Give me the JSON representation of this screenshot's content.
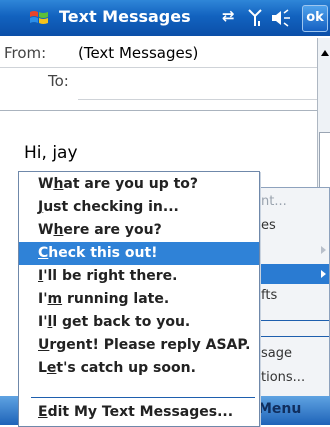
{
  "titlebar": {
    "title": "Text Messages",
    "ok_label": "ok",
    "icons": [
      "windows-flag-icon",
      "connectivity-icon",
      "signal-icon",
      "volume-icon"
    ]
  },
  "header": {
    "from_label": "From:",
    "from_value": "(Text Messages)",
    "to_label": "To:",
    "to_value": ""
  },
  "message": {
    "body": "Hi, jay"
  },
  "main_menu": {
    "items": [
      "nt...",
      "es",
      "fts",
      "sage",
      "tions..."
    ]
  },
  "popup_menu": {
    "items": [
      {
        "label": "What are you up to?",
        "underline_index": 1
      },
      {
        "label": "Just checking in...",
        "underline_index": 0
      },
      {
        "label": "Where are you?",
        "underline_index": 1
      },
      {
        "label": "Check this out!",
        "underline_index": 0,
        "selected": true
      },
      {
        "label": "I'll be right there.",
        "underline_index": 0
      },
      {
        "label": "I'm running late.",
        "underline_index": 2
      },
      {
        "label": "I'll get back to you.",
        "underline_index": 2
      },
      {
        "label": "Urgent! Please reply ASAP.",
        "underline_index": 0
      },
      {
        "label": "Let's catch up soon.",
        "underline_index": 1
      }
    ],
    "edit_label": "Edit My Text Messages...",
    "edit_underline_index": 0
  },
  "softkeys": {
    "right": "Menu"
  },
  "colors": {
    "titlebar": "#1262bf",
    "selection": "#2f82d7",
    "separator": "#1e5fae"
  }
}
